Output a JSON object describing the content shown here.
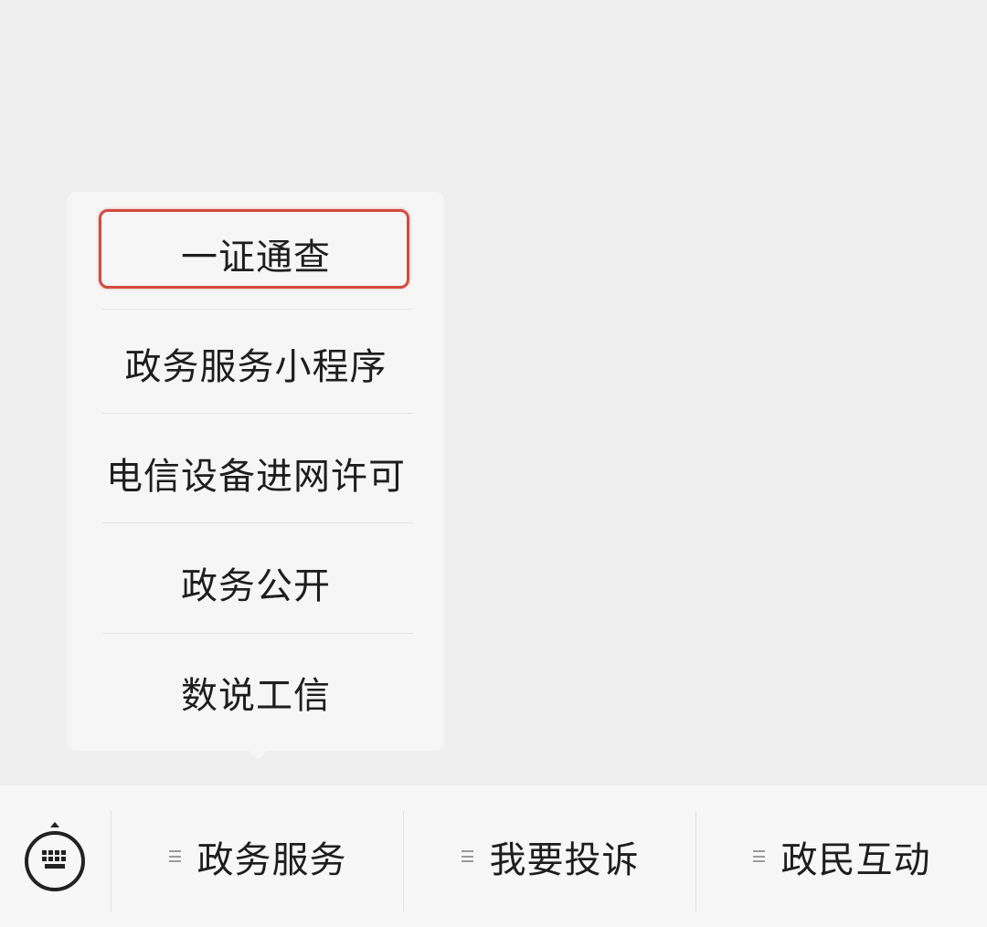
{
  "popup_menu": {
    "items": [
      {
        "label": "一证通查",
        "highlighted": true
      },
      {
        "label": "政务服务小程序"
      },
      {
        "label": "电信设备进网许可"
      },
      {
        "label": "政务公开"
      },
      {
        "label": "数说工信"
      }
    ],
    "highlight_color": "#d44a3e"
  },
  "bottom_bar": {
    "keyboard_icon": "keyboard-icon",
    "tabs": [
      {
        "label": "政务服务",
        "icon": "menu-icon"
      },
      {
        "label": "我要投诉",
        "icon": "menu-icon"
      },
      {
        "label": "政民互动",
        "icon": "menu-icon"
      }
    ]
  }
}
